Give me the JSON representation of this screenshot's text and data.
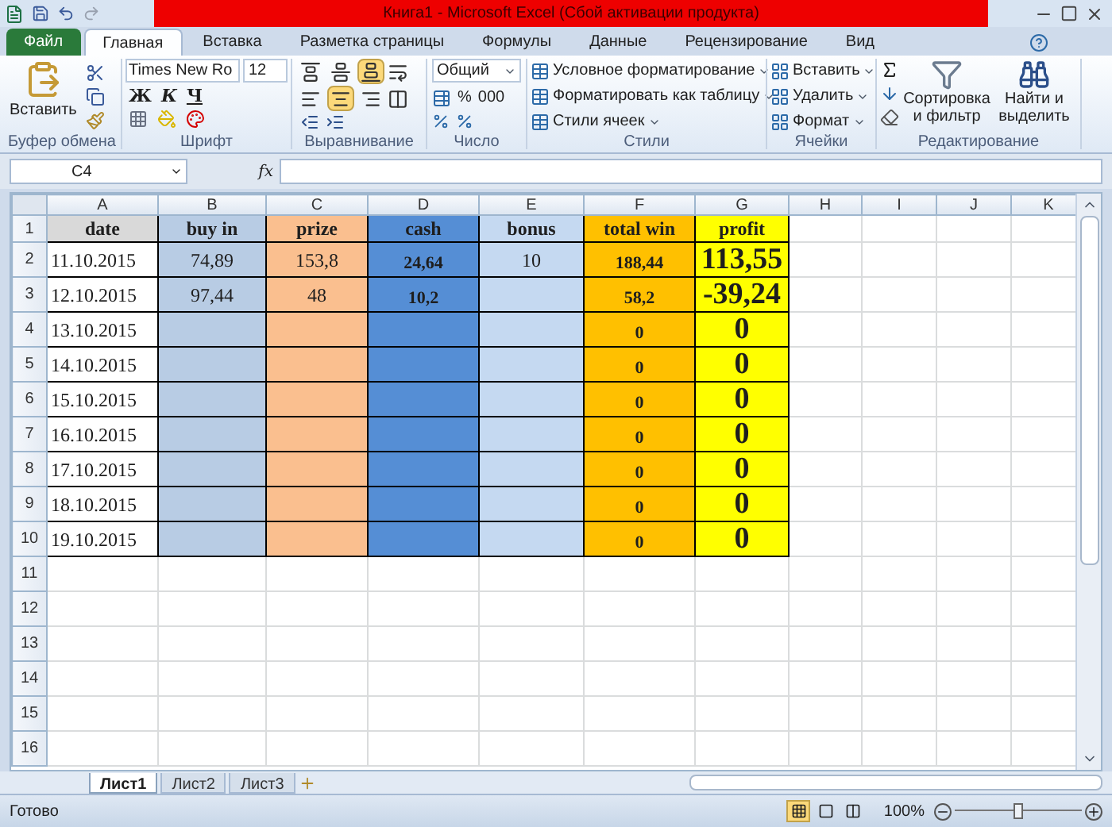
{
  "window": {
    "title": "Книга1  -  Microsoft Excel (Сбой активации продукта)"
  },
  "ribbon_tabs": [
    {
      "label": "Файл",
      "kind": "file",
      "selected": false
    },
    {
      "label": "Главная",
      "kind": "tab",
      "selected": true
    },
    {
      "label": "Вставка",
      "kind": "tab",
      "selected": false
    },
    {
      "label": "Разметка страницы",
      "kind": "tab",
      "selected": false
    },
    {
      "label": "Формулы",
      "kind": "tab",
      "selected": false
    },
    {
      "label": "Данные",
      "kind": "tab",
      "selected": false
    },
    {
      "label": "Рецензирование",
      "kind": "tab",
      "selected": false
    },
    {
      "label": "Вид",
      "kind": "tab",
      "selected": false
    }
  ],
  "ribbon": {
    "clipboard": {
      "label": "Буфер обмена",
      "paste": "Вставить"
    },
    "font": {
      "label": "Шрифт",
      "name": "Times New Ro",
      "size": "12",
      "bold": "Ж",
      "italic": "К",
      "underline": "Ч"
    },
    "alignment": {
      "label": "Выравнивание",
      "vertical": [
        {
          "kind": "top",
          "selected": false
        },
        {
          "kind": "middle",
          "selected": false
        },
        {
          "kind": "bottom",
          "selected": true
        }
      ],
      "horizontal": [
        {
          "kind": "left",
          "selected": false
        },
        {
          "kind": "center",
          "selected": true
        },
        {
          "kind": "right",
          "selected": false
        }
      ]
    },
    "number": {
      "label": "Число",
      "format": "Общий",
      "percent": "%",
      "thousands": "000"
    },
    "styles": {
      "label": "Стили",
      "items": [
        "Условное форматирование",
        "Форматировать как таблицу",
        "Стили ячеек"
      ]
    },
    "cells": {
      "label": "Ячейки",
      "items": [
        "Вставить",
        "Удалить",
        "Формат"
      ]
    },
    "editing": {
      "label": "Редактирование",
      "sort": "Сортировка и фильтр",
      "find": "Найти и выделить"
    }
  },
  "formula_bar": {
    "name_box": "C4",
    "fx": "fx"
  },
  "sheet": {
    "columns": [
      {
        "letter": "A",
        "color": "#d9d9d9",
        "filled": false,
        "kind": "date"
      },
      {
        "letter": "B",
        "color": "#b8cce4",
        "filled": true,
        "kind": "plain"
      },
      {
        "letter": "C",
        "color": "#fabf8f",
        "filled": true,
        "kind": "plain"
      },
      {
        "letter": "D",
        "color": "#558ed5",
        "filled": true,
        "kind": "bold"
      },
      {
        "letter": "E",
        "color": "#c5d9f1",
        "filled": true,
        "kind": "plain"
      },
      {
        "letter": "F",
        "color": "#ffc000",
        "filled": true,
        "kind": "bold"
      },
      {
        "letter": "G",
        "color": "#ffff00",
        "filled": true,
        "kind": "large"
      },
      {
        "letter": "H"
      },
      {
        "letter": "I"
      },
      {
        "letter": "J"
      },
      {
        "letter": "K"
      }
    ],
    "rows": [
      {
        "number": "1",
        "cells": [
          "date",
          "buy in",
          "prize",
          "cash",
          "bonus",
          "total win",
          "profit"
        ]
      },
      {
        "number": "2",
        "cells": [
          "11.10.2015",
          "74,89",
          "153,8",
          "24,64",
          "10",
          "188,44",
          "113,55"
        ]
      },
      {
        "number": "3",
        "cells": [
          "12.10.2015",
          "97,44",
          "48",
          "10,2",
          null,
          "58,2",
          "-39,24"
        ]
      },
      {
        "number": "4",
        "cells": [
          "13.10.2015",
          null,
          null,
          null,
          null,
          "0",
          "0"
        ]
      },
      {
        "number": "5",
        "cells": [
          "14.10.2015",
          null,
          null,
          null,
          null,
          "0",
          "0"
        ]
      },
      {
        "number": "6",
        "cells": [
          "15.10.2015",
          null,
          null,
          null,
          null,
          "0",
          "0"
        ]
      },
      {
        "number": "7",
        "cells": [
          "16.10.2015",
          null,
          null,
          null,
          null,
          "0",
          "0"
        ]
      },
      {
        "number": "8",
        "cells": [
          "17.10.2015",
          null,
          null,
          null,
          null,
          "0",
          "0"
        ]
      },
      {
        "number": "9",
        "cells": [
          "18.10.2015",
          null,
          null,
          null,
          null,
          "0",
          "0"
        ]
      },
      {
        "number": "10",
        "cells": [
          "19.10.2015",
          null,
          null,
          null,
          null,
          "0",
          "0"
        ]
      },
      {
        "number": "11"
      },
      {
        "number": "12"
      },
      {
        "number": "13"
      },
      {
        "number": "14"
      },
      {
        "number": "15"
      },
      {
        "number": "16"
      }
    ]
  },
  "sheet_tabs": [
    {
      "label": "Лист1",
      "selected": true
    },
    {
      "label": "Лист2",
      "selected": false
    },
    {
      "label": "Лист3",
      "selected": false
    }
  ],
  "status_bar": {
    "text": "Готово",
    "views": [
      {
        "kind": "normal",
        "selected": true
      },
      {
        "kind": "layout",
        "selected": false
      },
      {
        "kind": "break",
        "selected": false
      }
    ],
    "zoom": "100%",
    "level": 0.5
  }
}
